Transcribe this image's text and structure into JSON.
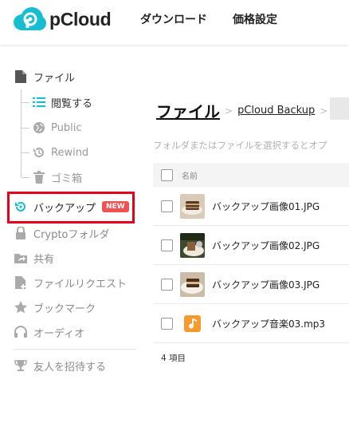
{
  "header": {
    "brand": "pCloud",
    "nav": [
      "ダウンロード",
      "価格設定"
    ],
    "brand_color": "#17bed0"
  },
  "sidebar": {
    "files": "ファイル",
    "sub": [
      {
        "label": "閲覧する",
        "icon": "list-icon"
      },
      {
        "label": "Public",
        "icon": "globe-icon"
      },
      {
        "label": "Rewind",
        "icon": "history-icon"
      },
      {
        "label": "ゴミ箱",
        "icon": "trash-icon"
      }
    ],
    "backup": "バックアップ",
    "new_badge": "NEW",
    "items": [
      {
        "label": "Cryptoフォルダ",
        "icon": "lock-icon"
      },
      {
        "label": "共有",
        "icon": "share-icon"
      },
      {
        "label": "ファイルリクエスト",
        "icon": "file-request-icon"
      },
      {
        "label": "ブックマーク",
        "icon": "star-icon"
      },
      {
        "label": "オーディオ",
        "icon": "headphones-icon"
      }
    ],
    "invite": "友人を招待する",
    "highlight_color": "#e4001d"
  },
  "main": {
    "breadcrumb_title": "ファイル",
    "breadcrumb_sep": ">",
    "breadcrumb_link": "pCloud Backup",
    "hint": "フォルダまたはファイルを選択するとオプ",
    "column_name": "名前",
    "files": [
      {
        "name": "バックアップ画像01.JPG",
        "type": "image"
      },
      {
        "name": "バックアップ画像02.JPG",
        "type": "image"
      },
      {
        "name": "バックアップ画像03.JPG",
        "type": "image"
      },
      {
        "name": "バックアップ音楽03.mp3",
        "type": "audio"
      }
    ],
    "count": "4 項目"
  }
}
